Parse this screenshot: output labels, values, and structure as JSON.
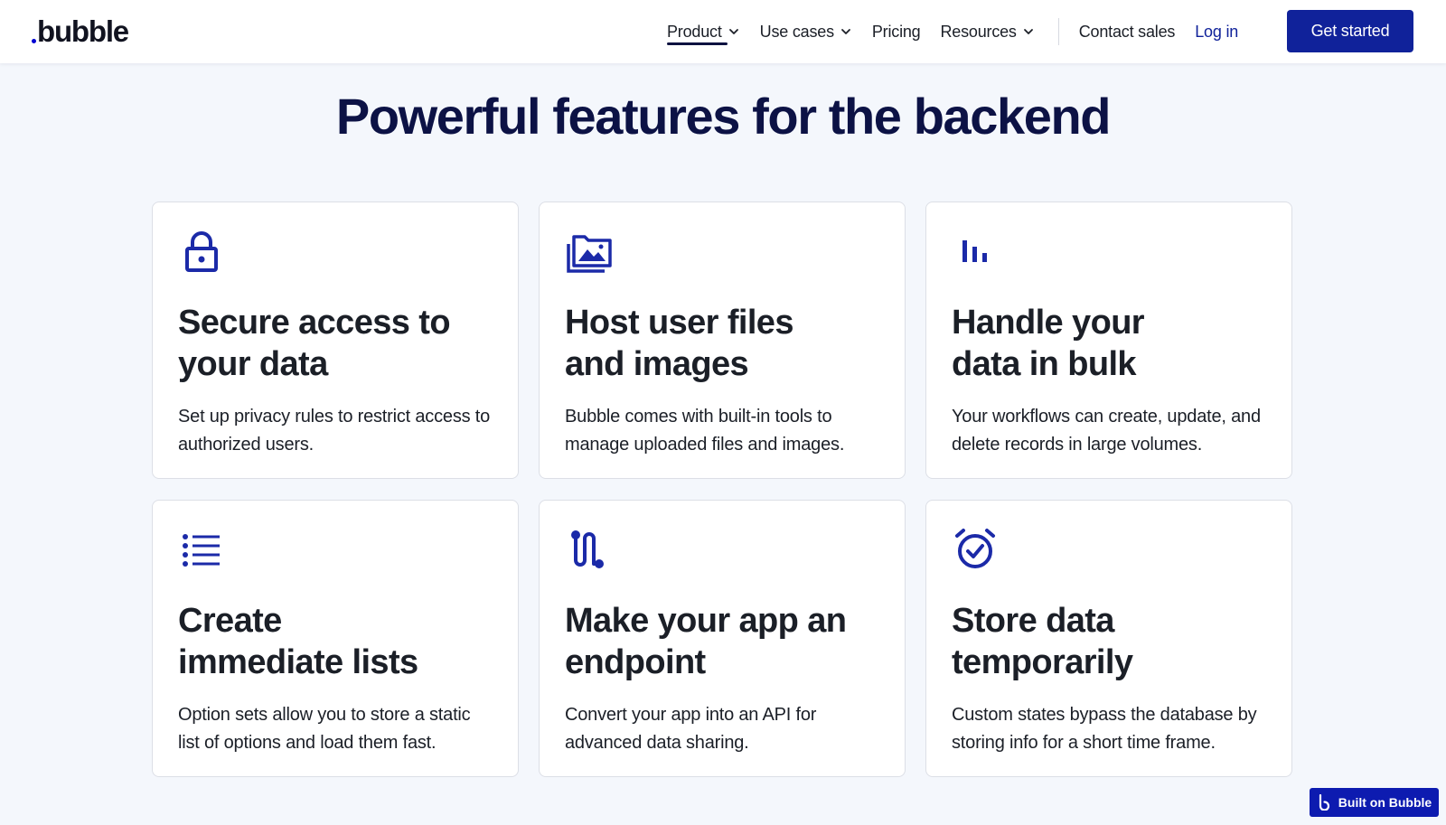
{
  "header": {
    "logo_text": "bubble",
    "nav": [
      {
        "label": "Product",
        "has_dropdown": true,
        "active": true
      },
      {
        "label": "Use cases",
        "has_dropdown": true,
        "active": false
      },
      {
        "label": "Pricing",
        "has_dropdown": false,
        "active": false
      },
      {
        "label": "Resources",
        "has_dropdown": true,
        "active": false
      }
    ],
    "contact_label": "Contact sales",
    "login_label": "Log in",
    "cta_label": "Get started"
  },
  "main": {
    "headline": "Powerful features for the backend",
    "cards": [
      {
        "icon": "lock-icon",
        "title": "Secure access to\nyour data",
        "description": "Set up privacy rules to restrict access to authorized users."
      },
      {
        "icon": "images-icon",
        "title": "Host user files\nand images",
        "description": "Bubble comes with built-in tools to manage uploaded files and images."
      },
      {
        "icon": "bar-chart-icon",
        "title": "Handle your\ndata in bulk",
        "description": "Your workflows can create, update, and delete records in large volumes."
      },
      {
        "icon": "list-icon",
        "title": "Create\nimmediate lists",
        "description": "Option sets allow you to store a static list of options and load them fast."
      },
      {
        "icon": "route-icon",
        "title": "Make your app an\nendpoint",
        "description": "Convert your app into an API for advanced data sharing."
      },
      {
        "icon": "alarm-check-icon",
        "title": "Store data\ntemporarily",
        "description": "Custom states bypass the database by storing info for a short time frame."
      }
    ]
  },
  "badge": {
    "label": "Built on Bubble"
  },
  "colors": {
    "brand": "#10229a",
    "headline": "#0c1245",
    "background": "#f4f7fc",
    "icon": "#1b2aa8"
  }
}
